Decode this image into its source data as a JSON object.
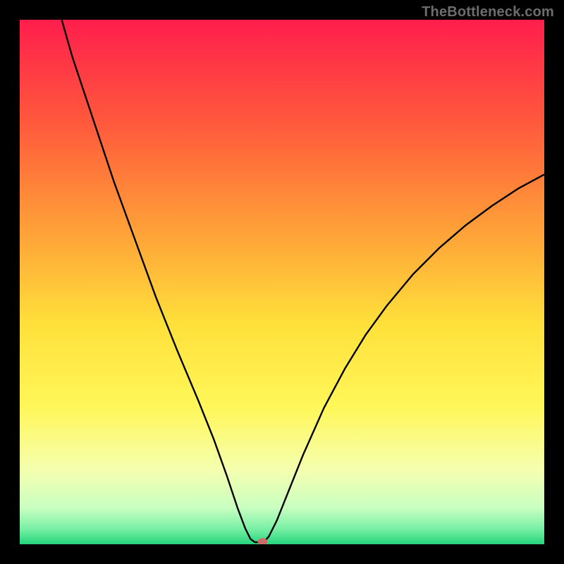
{
  "watermark": "TheBottleneck.com",
  "chart_data": {
    "type": "line",
    "title": "",
    "xlabel": "",
    "ylabel": "",
    "xlim": [
      0,
      100
    ],
    "ylim": [
      0,
      100
    ],
    "background_gradient": {
      "stops": [
        {
          "offset": 0.0,
          "color": "#ff1e4c"
        },
        {
          "offset": 0.2,
          "color": "#ff5a3c"
        },
        {
          "offset": 0.4,
          "color": "#ffa038"
        },
        {
          "offset": 0.58,
          "color": "#ffe03a"
        },
        {
          "offset": 0.74,
          "color": "#fff75a"
        },
        {
          "offset": 0.86,
          "color": "#f4ffb0"
        },
        {
          "offset": 0.93,
          "color": "#c9ffc0"
        },
        {
          "offset": 0.97,
          "color": "#7af0a6"
        },
        {
          "offset": 1.0,
          "color": "#26d47b"
        }
      ]
    },
    "curve_points": [
      {
        "x": 8.0,
        "y": 100.0
      },
      {
        "x": 10.0,
        "y": 93.0
      },
      {
        "x": 14.0,
        "y": 81.0
      },
      {
        "x": 18.0,
        "y": 69.0
      },
      {
        "x": 22.0,
        "y": 58.0
      },
      {
        "x": 26.0,
        "y": 47.0
      },
      {
        "x": 30.0,
        "y": 37.0
      },
      {
        "x": 34.0,
        "y": 27.5
      },
      {
        "x": 37.0,
        "y": 20.0
      },
      {
        "x": 39.5,
        "y": 13.0
      },
      {
        "x": 41.5,
        "y": 7.0
      },
      {
        "x": 43.0,
        "y": 3.0
      },
      {
        "x": 44.0,
        "y": 1.0
      },
      {
        "x": 44.8,
        "y": 0.4
      },
      {
        "x": 46.5,
        "y": 0.4
      },
      {
        "x": 47.5,
        "y": 1.5
      },
      {
        "x": 49.0,
        "y": 4.5
      },
      {
        "x": 51.0,
        "y": 9.5
      },
      {
        "x": 54.0,
        "y": 17.0
      },
      {
        "x": 58.0,
        "y": 26.0
      },
      {
        "x": 62.0,
        "y": 33.5
      },
      {
        "x": 66.0,
        "y": 40.0
      },
      {
        "x": 70.0,
        "y": 45.5
      },
      {
        "x": 75.0,
        "y": 51.5
      },
      {
        "x": 80.0,
        "y": 56.5
      },
      {
        "x": 85.0,
        "y": 60.8
      },
      {
        "x": 90.0,
        "y": 64.5
      },
      {
        "x": 95.0,
        "y": 67.8
      },
      {
        "x": 100.0,
        "y": 70.5
      }
    ],
    "marker": {
      "x": 46.3,
      "y": 0.5,
      "color": "#cf6a6a"
    }
  }
}
